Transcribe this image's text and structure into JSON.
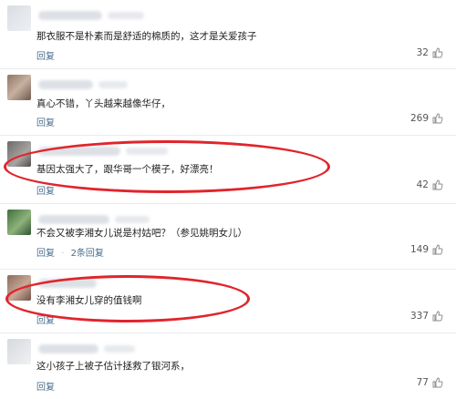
{
  "colors": {
    "highlight": "#e1242c",
    "reply_link": "#4a6d8c",
    "text": "#222222"
  },
  "comments": [
    {
      "text": "那衣服不是朴素而是舒适的棉质的，这才是关爱孩子",
      "actions": [
        "回复"
      ],
      "likes": "32",
      "icon": "thumbs-up-icon"
    },
    {
      "text": "真心不错，丫头越来越像华仔，",
      "actions": [
        "回复"
      ],
      "likes": "269",
      "icon": "thumbs-up-icon"
    },
    {
      "text": "基因太强大了，跟华哥一个模子，好漂亮！",
      "actions": [
        "回复"
      ],
      "likes": "42",
      "icon": "thumbs-up-icon",
      "highlighted": true
    },
    {
      "text": "不会又被李湘女儿说是村姑吧？（参见姚明女儿）",
      "actions": [
        "回复",
        "2条回复"
      ],
      "likes": "149",
      "icon": "thumbs-up-icon"
    },
    {
      "text": "没有李湘女儿穿的值钱啊",
      "actions": [
        "回复"
      ],
      "likes": "337",
      "icon": "thumbs-up-icon",
      "highlighted": true
    },
    {
      "text": "这小孩子上被子估计拯救了银河系，",
      "actions": [
        "回复"
      ],
      "likes": "77",
      "icon": "thumbs-up-icon"
    }
  ]
}
